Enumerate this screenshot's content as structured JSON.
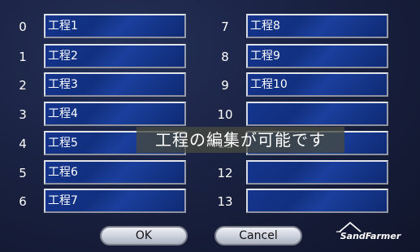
{
  "left_column": [
    {
      "index": "0",
      "value": "工程1"
    },
    {
      "index": "1",
      "value": "工程2"
    },
    {
      "index": "2",
      "value": "工程3"
    },
    {
      "index": "3",
      "value": "工程4"
    },
    {
      "index": "4",
      "value": "工程5"
    },
    {
      "index": "5",
      "value": "工程6"
    },
    {
      "index": "6",
      "value": "工程7"
    }
  ],
  "right_column": [
    {
      "index": "7",
      "value": "工程8"
    },
    {
      "index": "8",
      "value": "工程9"
    },
    {
      "index": "9",
      "value": "工程10"
    },
    {
      "index": "10",
      "value": ""
    },
    {
      "index": "11",
      "value": ""
    },
    {
      "index": "12",
      "value": ""
    },
    {
      "index": "13",
      "value": ""
    }
  ],
  "toast_message": "工程の編集が可能です",
  "buttons": {
    "ok": "OK",
    "cancel": "Cancel"
  },
  "logo_text": "SandFarmer",
  "colors": {
    "field_blue": "#14358f",
    "background": "#1a2242"
  }
}
